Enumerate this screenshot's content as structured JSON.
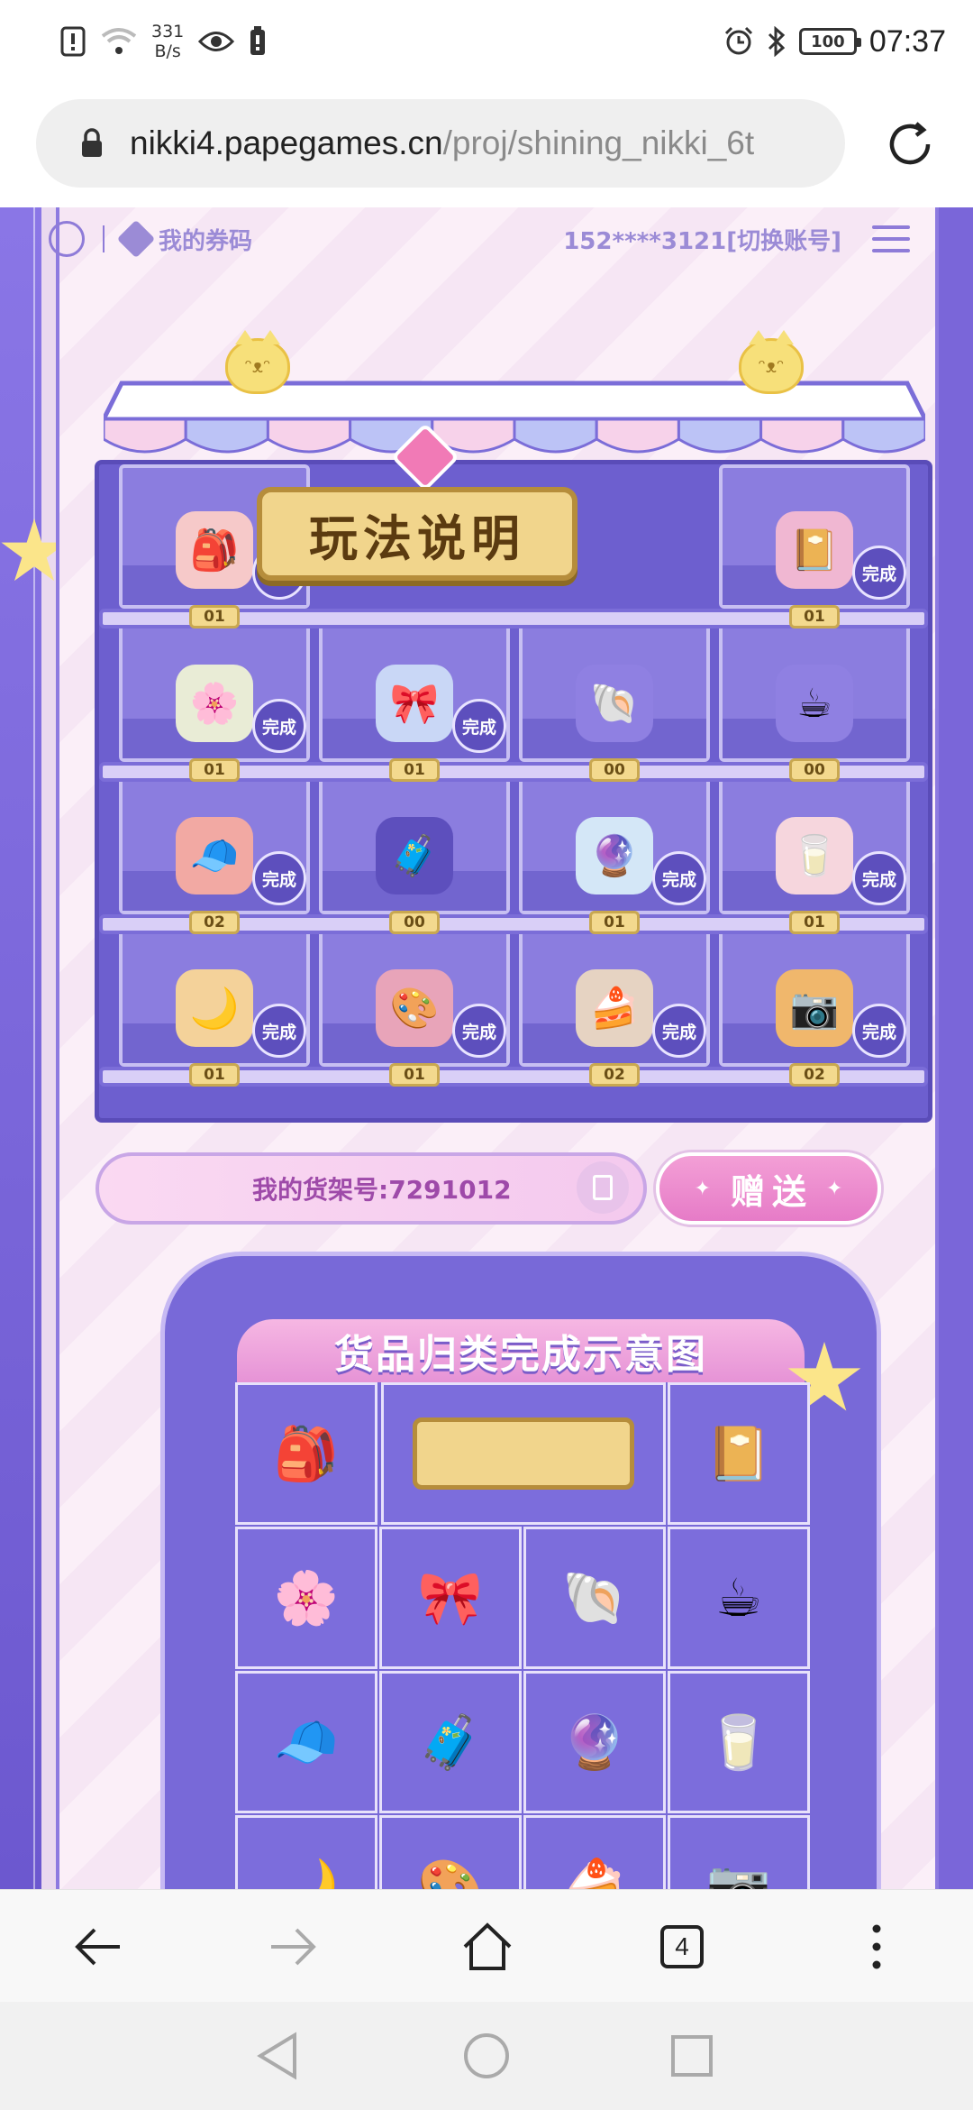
{
  "status_bar": {
    "net_speed_value": "331",
    "net_speed_unit": "B/s",
    "battery": "100",
    "time": "07:37",
    "icons": [
      "notification-icon",
      "wifi-icon",
      "eye-icon",
      "battery-saver-icon",
      "alarm-icon",
      "bluetooth-icon"
    ]
  },
  "browser": {
    "url_host": "nikki4.papegames.cn",
    "url_path": "/proj/shining_nikki_6t",
    "tab_count": "4"
  },
  "page": {
    "nav": {
      "ticket_label": "我的券码",
      "account_text": "152****3121[切换账号]"
    },
    "shelf": {
      "banner_text": "玩法说明",
      "done_label": "完成",
      "rows": [
        [
          {
            "name": "rabbit-backpack",
            "icon": "🎒",
            "count": "01",
            "color": "#f6c9c9"
          },
          {
            "name": "banner",
            "icon": "",
            "count": "",
            "color": ""
          },
          {
            "name": "banner",
            "icon": "",
            "count": "",
            "color": ""
          },
          {
            "name": "photo-album",
            "icon": "📔",
            "count": "01",
            "color": "#f0b7d2"
          }
        ],
        [
          {
            "name": "flower-basket",
            "icon": "🌸",
            "count": "01",
            "color": "#e9ecd6"
          },
          {
            "name": "perfume-bottle",
            "icon": "🎀",
            "count": "01",
            "color": "#c9d7f6"
          },
          {
            "name": "shell-box",
            "icon": "🐚",
            "count": "00",
            "color": "#8f80e2"
          },
          {
            "name": "bunny-mug",
            "icon": "☕",
            "count": "00",
            "color": "#8f80e2"
          }
        ],
        [
          {
            "name": "cat-hat",
            "icon": "🧢",
            "count": "02",
            "color": "#f2a9a3"
          },
          {
            "name": "suitcase",
            "icon": "🧳",
            "count": "00",
            "color": "#5d4fbd"
          },
          {
            "name": "crystal-ball",
            "icon": "🔮",
            "count": "01",
            "color": "#d4e7f7"
          },
          {
            "name": "milk-box",
            "icon": "🥛",
            "count": "01",
            "color": "#f6d6dd"
          }
        ],
        [
          {
            "name": "moon-pillow",
            "icon": "🌙",
            "count": "01",
            "color": "#f4d29a"
          },
          {
            "name": "eyeshadow-palette",
            "icon": "🎨",
            "count": "01",
            "color": "#e8a4b9"
          },
          {
            "name": "cake-slice",
            "icon": "🍰",
            "count": "02",
            "color": "#e6d3c2"
          },
          {
            "name": "camera",
            "icon": "📷",
            "count": "02",
            "color": "#f0b76c"
          }
        ]
      ]
    },
    "shelf_number_label": "我的货架号:7291012",
    "gift_button": "赠送",
    "guide": {
      "title": "货品归类完成示意图",
      "cells": [
        "🎒",
        "📔",
        "🌸",
        "🎀",
        "🐚",
        "☕",
        "🧢",
        "🧳",
        "🔮",
        "🥛",
        "🌙",
        "🎨",
        "🍰",
        "📷"
      ]
    }
  }
}
